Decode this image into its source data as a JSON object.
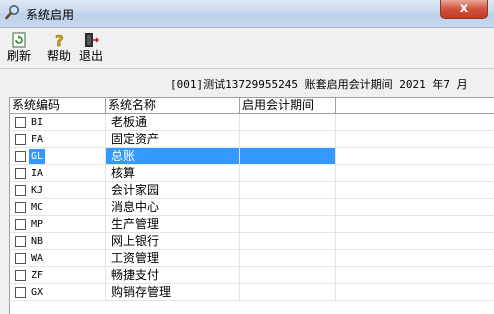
{
  "window": {
    "title": "系统启用",
    "close_label": "x"
  },
  "toolbar": {
    "refresh_label": "刷新",
    "help_label": "帮助",
    "exit_label": "退出"
  },
  "info_line": "[001]测试13729955245 账套启用会计期间 2021 年7 月",
  "table": {
    "headers": [
      "系统编码",
      "系统名称",
      "启用会计期间",
      ""
    ],
    "rows": [
      {
        "code": "BI",
        "name": "老板通",
        "period": ""
      },
      {
        "code": "FA",
        "name": "固定资产",
        "period": ""
      },
      {
        "code": "GL",
        "name": "总账",
        "period": "",
        "selected": true
      },
      {
        "code": "IA",
        "name": "核算",
        "period": ""
      },
      {
        "code": "KJ",
        "name": "会计家园",
        "period": ""
      },
      {
        "code": "MC",
        "name": "消息中心",
        "period": ""
      },
      {
        "code": "MP",
        "name": "生产管理",
        "period": ""
      },
      {
        "code": "NB",
        "name": "网上银行",
        "period": ""
      },
      {
        "code": "WA",
        "name": "工资管理",
        "period": ""
      },
      {
        "code": "ZF",
        "name": "畅捷支付",
        "period": ""
      },
      {
        "code": "GX",
        "name": "购销存管理",
        "period": ""
      }
    ]
  },
  "icons": {
    "title": "magnifier-icon",
    "refresh": "refresh-icon",
    "help": "help-icon",
    "exit": "exit-door-icon"
  }
}
